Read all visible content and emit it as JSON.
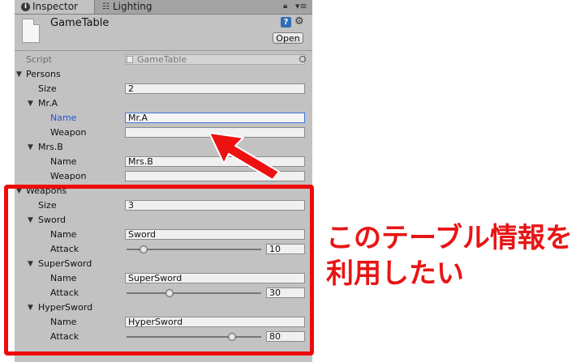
{
  "tabs": {
    "inspector": "Inspector",
    "lighting": "Lighting"
  },
  "header": {
    "title": "GameTable",
    "open_label": "Open"
  },
  "script": {
    "label": "Script",
    "value": "GameTable"
  },
  "persons": {
    "label": "Persons",
    "size_label": "Size",
    "size": "2",
    "items": [
      {
        "label": "Mr.A",
        "name_label": "Name",
        "name": "Mr.A",
        "weapon_label": "Weapon",
        "weapon": ""
      },
      {
        "label": "Mrs.B",
        "name_label": "Name",
        "name": "Mrs.B",
        "weapon_label": "Weapon",
        "weapon": ""
      }
    ]
  },
  "weapons": {
    "label": "Weapons",
    "size_label": "Size",
    "size": "3",
    "items": [
      {
        "label": "Sword",
        "name_label": "Name",
        "name": "Sword",
        "attack_label": "Attack",
        "attack": "10",
        "attack_fraction": 0.1
      },
      {
        "label": "SuperSword",
        "name_label": "Name",
        "name": "SuperSword",
        "attack_label": "Attack",
        "attack": "30",
        "attack_fraction": 0.31
      },
      {
        "label": "HyperSword",
        "name_label": "Name",
        "name": "HyperSword",
        "attack_label": "Attack",
        "attack": "80",
        "attack_fraction": 0.8
      }
    ]
  },
  "annotation": {
    "line1": "このテーブル情報を",
    "line2": "利用したい"
  },
  "colors": {
    "annotation": "#e81515",
    "focus": "#3c78d8"
  }
}
